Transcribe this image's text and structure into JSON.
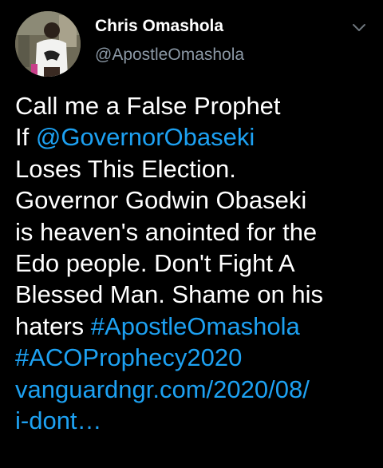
{
  "tweet": {
    "author": {
      "display_name": "Chris Omashola",
      "handle": "@ApostleOmashola"
    },
    "menu_icon": "chevron-down-icon",
    "body": {
      "line1": "Call me a False Prophet",
      "line2_prefix": "If ",
      "mention": "@GovernorObaseki",
      "line3": "Loses This Election.",
      "line4": "Governor Godwin Obaseki",
      "line5": "is heaven's anointed for the",
      "line6": "Edo people. Don't Fight A",
      "line7": "Blessed Man. Shame on his",
      "line8_prefix": "haters ",
      "hashtag1": "#ApostleOmashola",
      "hashtag2": "#ACOProphecy2020",
      "link_part1": "vanguardngr.com/2020/08/",
      "link_part2": "i-dont…"
    }
  },
  "colors": {
    "background": "#000000",
    "text": "#ffffff",
    "secondary_text": "#8b98a5",
    "link": "#1da1f2"
  }
}
